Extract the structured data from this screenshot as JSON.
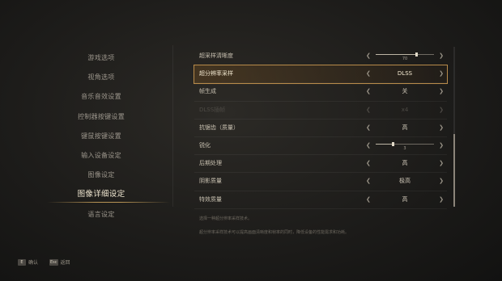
{
  "nav": {
    "items": [
      {
        "label": "游戏选项",
        "active": false
      },
      {
        "label": "视角选项",
        "active": false
      },
      {
        "label": "音乐音效设置",
        "active": false
      },
      {
        "label": "控制器按键设置",
        "active": false
      },
      {
        "label": "键鼠按键设置",
        "active": false
      },
      {
        "label": "输入设备设定",
        "active": false
      },
      {
        "label": "图像设定",
        "active": false
      },
      {
        "label": "图像详细设定",
        "active": true
      },
      {
        "label": "语言设定",
        "active": false
      }
    ]
  },
  "settings": {
    "rows": [
      {
        "label": "超采样清晰度",
        "type": "slider",
        "value": "70",
        "level": 0.7
      },
      {
        "label": "超分辨率采样",
        "type": "option",
        "value": "DLSS",
        "selected": true
      },
      {
        "label": "帧生成",
        "type": "option",
        "value": "关"
      },
      {
        "label": "DLSS插帧",
        "type": "option",
        "value": "x4",
        "disabled": true
      },
      {
        "label": "抗锯齿（质量）",
        "type": "option",
        "value": "高"
      },
      {
        "label": "锐化",
        "type": "slider",
        "value": "3",
        "level": 0.3
      },
      {
        "label": "后期处理",
        "type": "option",
        "value": "高"
      },
      {
        "label": "阴影质量",
        "type": "option",
        "value": "极高"
      },
      {
        "label": "特效质量",
        "type": "option",
        "value": "高"
      }
    ]
  },
  "description": {
    "line1": "选择一种超分辨率采样技术。",
    "line2": "超分辨率采样技术可以提高画面清晰度和帧率的同时，降低设备的性能需求和功耗。"
  },
  "hints": {
    "confirm_key": "E",
    "confirm_label": "确认",
    "back_key": "Esc",
    "back_label": "返回"
  },
  "colors": {
    "accent": "#b88b4a",
    "background": "#1d1c1a"
  }
}
